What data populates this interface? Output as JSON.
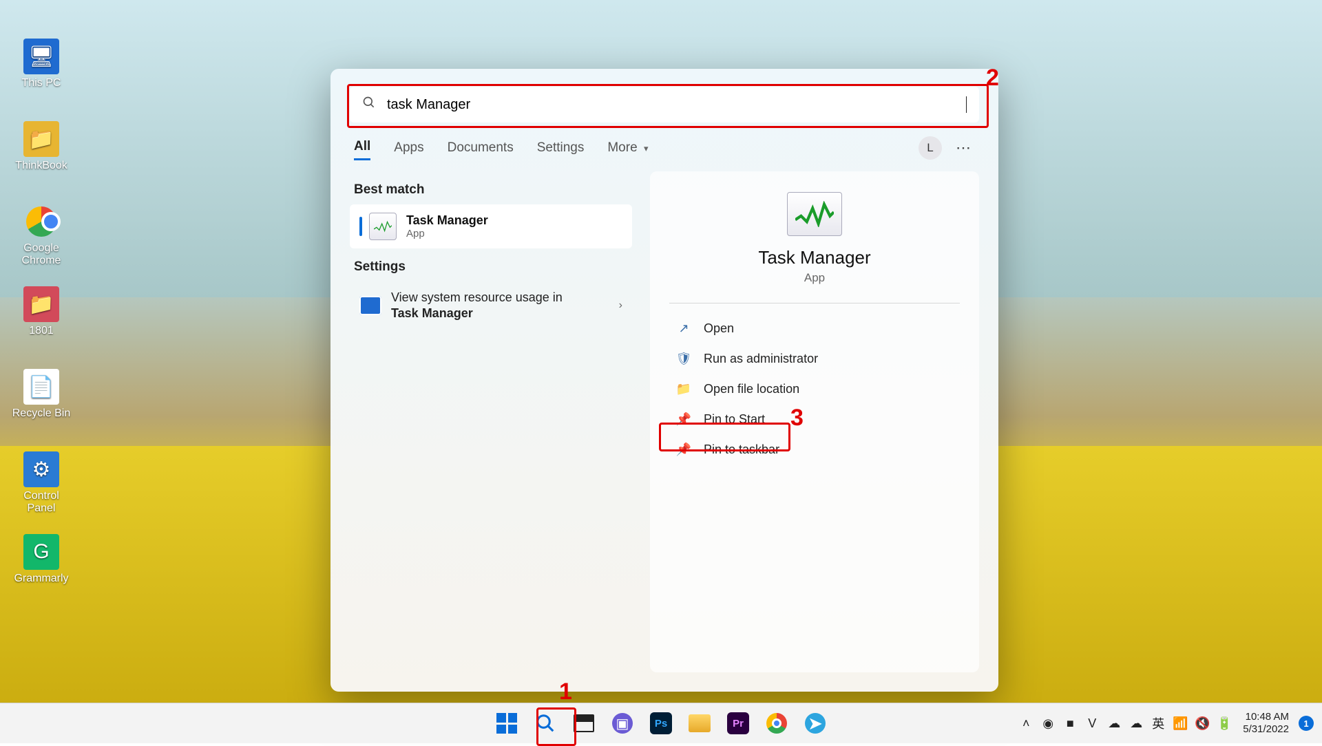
{
  "desktop_icons": [
    {
      "label": "This PC",
      "color": "#1f6bd0",
      "glyph": "🖥"
    },
    {
      "label": "ThinkBook",
      "color": "#e7b532",
      "glyph": "📁"
    },
    {
      "label": "Google Chrome",
      "color": "",
      "glyph": "chrome"
    },
    {
      "label": "1801",
      "color": "#d24a5a",
      "glyph": "📁"
    },
    {
      "label": "Recycle Bin",
      "color": "#ffffff",
      "glyph": "📄"
    },
    {
      "label": "Control Panel",
      "color": "#2a7bd4",
      "glyph": "⚙"
    },
    {
      "label": "Grammarly",
      "color": "#12b76a",
      "glyph": "G"
    }
  ],
  "search": {
    "value": "task Manager"
  },
  "tabs": [
    "All",
    "Apps",
    "Documents",
    "Settings",
    "More"
  ],
  "user_initial": "L",
  "best_match_head": "Best match",
  "best_match": {
    "title": "Task Manager",
    "sub": "App"
  },
  "settings_head": "Settings",
  "settings_item": {
    "prefix": "View system resource usage in ",
    "bold": "Task Manager"
  },
  "preview": {
    "title": "Task Manager",
    "sub": "App"
  },
  "actions": [
    {
      "key": "open",
      "label": "Open",
      "icon": "↗"
    },
    {
      "key": "admin",
      "label": "Run as administrator",
      "icon": "🛡"
    },
    {
      "key": "loc",
      "label": "Open file location",
      "icon": "📁"
    },
    {
      "key": "pinstart",
      "label": "Pin to Start",
      "icon": "📌"
    },
    {
      "key": "pintask",
      "label": "Pin to taskbar",
      "icon": "📌"
    }
  ],
  "taskbar_apps": [
    {
      "key": "start",
      "name": "start-button"
    },
    {
      "key": "search",
      "name": "taskbar-search-button"
    },
    {
      "key": "taskview",
      "name": "task-view-button"
    },
    {
      "key": "chat",
      "name": "chat-app"
    },
    {
      "key": "ps",
      "name": "photoshop-app"
    },
    {
      "key": "explorer",
      "name": "file-explorer-app"
    },
    {
      "key": "pr",
      "name": "premiere-app"
    },
    {
      "key": "chrome",
      "name": "chrome-app"
    },
    {
      "key": "telegram",
      "name": "telegram-app"
    }
  ],
  "tray": [
    {
      "key": "up",
      "glyph": "˄"
    },
    {
      "key": "eye",
      "glyph": "◉"
    },
    {
      "key": "rec",
      "glyph": "■"
    },
    {
      "key": "v",
      "glyph": "V"
    },
    {
      "key": "onedrive",
      "glyph": "☁"
    },
    {
      "key": "cloud",
      "glyph": "☁"
    },
    {
      "key": "lang",
      "glyph": "英"
    },
    {
      "key": "wifi",
      "glyph": "📶"
    },
    {
      "key": "sound",
      "glyph": "🔇"
    },
    {
      "key": "battery",
      "glyph": "🔋"
    }
  ],
  "clock": {
    "time": "10:48 AM",
    "date": "5/31/2022"
  },
  "notif_count": "1",
  "annot": {
    "n1": "1",
    "n2": "2",
    "n3": "3"
  }
}
